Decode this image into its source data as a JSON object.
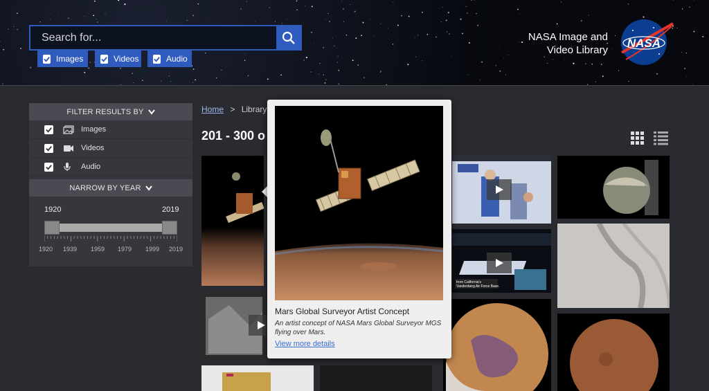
{
  "header": {
    "search": {
      "placeholder": "Search for..."
    },
    "filters": [
      {
        "label": "Images",
        "checked": true
      },
      {
        "label": "Videos",
        "checked": true
      },
      {
        "label": "Audio",
        "checked": true
      }
    ],
    "brand": {
      "line1": "NASA Image and",
      "line2": "Video Library"
    },
    "logo_text": "NASA"
  },
  "sidebar": {
    "filter_heading": "FILTER RESULTS BY",
    "media_types": [
      {
        "label": "Images",
        "icon": "image-icon"
      },
      {
        "label": "Videos",
        "icon": "video-camera-icon"
      },
      {
        "label": "Audio",
        "icon": "microphone-icon"
      }
    ],
    "year_heading": "NARROW BY YEAR",
    "year_start": "1920",
    "year_end": "2019",
    "year_ticks": [
      "1920",
      "1939",
      "1959",
      "1979",
      "1999",
      "2019"
    ]
  },
  "breadcrumb": {
    "home": "Home",
    "separator": ">",
    "current": "Library"
  },
  "results_label": "201 - 300 o",
  "popup": {
    "title": "Mars Global Surveyor Artist Concept",
    "description": "An artist concept of NASA Mars Global Surveyor MGS flying over Mars.",
    "link": "View more details"
  },
  "colors": {
    "accent": "#2e5bbd",
    "panel": "#36373d",
    "background": "#2a2b31"
  }
}
